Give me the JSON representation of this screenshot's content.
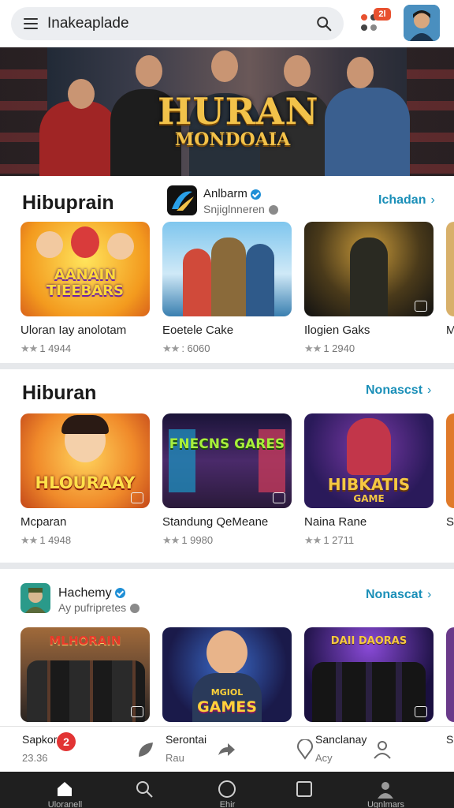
{
  "search": {
    "placeholder": "Inakeaplade",
    "menu_icon": "menu-icon",
    "icon": "search-icon"
  },
  "header": {
    "apps_icon": "apps-dots-icon",
    "notification_badge": "2l",
    "avatar_icon": "profile-avatar"
  },
  "banner": {
    "title_line1": "HURAN",
    "title_line2": "MONDOAIA"
  },
  "sections": [
    {
      "title": "Hibuprain",
      "developer": {
        "name": "Anlbarm",
        "sub": "Snjiglnneren",
        "logo_icon": "app-logo-icon"
      },
      "link_label": "Ichadan",
      "cards": [
        {
          "title": "Uloran Iay anolotam",
          "rating": "1 4944",
          "art_text": "AANAIN TIEEBARS"
        },
        {
          "title": "Eoetele Cake",
          "rating": ": 6060",
          "art_text": ""
        },
        {
          "title": "Ilogien Gaks",
          "rating": "1 2940",
          "art_text": ""
        }
      ],
      "peek_title": "M"
    },
    {
      "title": "Hiburan",
      "link_label": "Nonascst",
      "cards": [
        {
          "title": "Mcparan",
          "rating": "1 4948",
          "art_text": "HLOURAAY"
        },
        {
          "title": "Standung QeMeane",
          "rating": "1 9980",
          "art_text": "FNECNS GARES"
        },
        {
          "title": "Naina Rane",
          "rating": "1 2711",
          "art_text": "HIBKATIS",
          "art_text2": "GAME"
        }
      ],
      "peek_title": "S"
    },
    {
      "developer": {
        "name": "Hachemy",
        "sub": "Ay pufripretes",
        "logo_icon": "app-logo-icon"
      },
      "link_label": "Nonascat",
      "cards": [
        {
          "art_text": "MLHORAIN"
        },
        {
          "art_text": "MGIOL",
          "art_text2": "GAMES"
        },
        {
          "art_text": "DAII DAORAS"
        }
      ]
    }
  ],
  "bottom_strip": [
    {
      "t1": "Sapkor",
      "t2": "23.36",
      "badge": "2"
    },
    {
      "t1": "Serontai",
      "t2": "Rau"
    },
    {
      "t1": "Sanclanay",
      "t2": "Acy"
    },
    {
      "t1": "S",
      "t2": ""
    }
  ],
  "nav": [
    {
      "label": "Uloranell",
      "icon": "home-icon"
    },
    {
      "label": "",
      "icon": "search-icon"
    },
    {
      "label": "Ehir",
      "icon": "circle-icon"
    },
    {
      "label": "",
      "icon": "square-icon"
    },
    {
      "label": "Ugnlmars",
      "icon": "profile-icon"
    }
  ],
  "colors": {
    "accent": "#1a8fb8",
    "badge": "#e8512f",
    "navbar": "#1f1f1f",
    "divider": "#e6e8eb"
  }
}
